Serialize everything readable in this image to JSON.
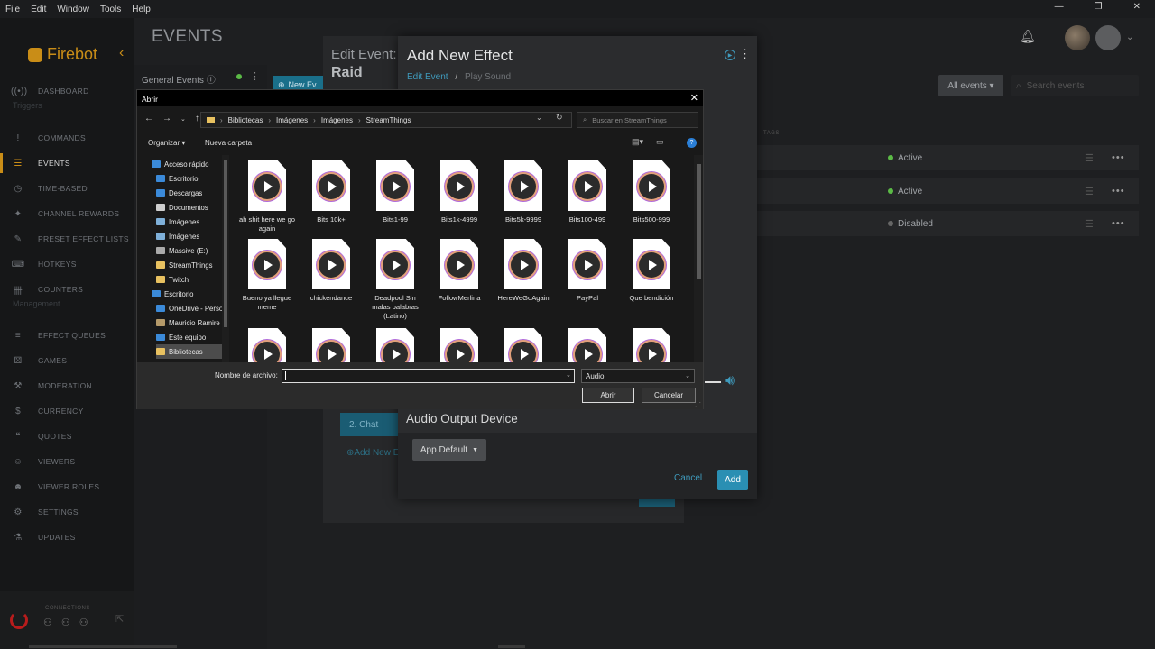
{
  "menu": [
    "File",
    "Edit",
    "Window",
    "Tools",
    "Help"
  ],
  "window_controls": [
    "—",
    "❐",
    "✕"
  ],
  "brand": "Firebot",
  "page_title": "EVENTS",
  "sidebar": {
    "triggers_label": "Triggers",
    "management_label": "Management",
    "items": [
      {
        "label": "DASHBOARD",
        "icon": "broadcast-icon",
        "glyph": "((•))"
      },
      {
        "label": "COMMANDS",
        "icon": "exclamation-icon",
        "glyph": "!"
      },
      {
        "label": "EVENTS",
        "icon": "list-icon",
        "glyph": "☰"
      },
      {
        "label": "TIME-BASED",
        "icon": "clock-icon",
        "glyph": "◷"
      },
      {
        "label": "CHANNEL REWARDS",
        "icon": "gift-icon",
        "glyph": "✦"
      },
      {
        "label": "PRESET EFFECT LISTS",
        "icon": "magic-icon",
        "glyph": "✎"
      },
      {
        "label": "HOTKEYS",
        "icon": "keyboard-icon",
        "glyph": "⌨"
      },
      {
        "label": "COUNTERS",
        "icon": "counter-icon",
        "glyph": "卌"
      },
      {
        "label": "EFFECT QUEUES",
        "icon": "queue-icon",
        "glyph": "≡"
      },
      {
        "label": "GAMES",
        "icon": "dice-icon",
        "glyph": "⚄"
      },
      {
        "label": "MODERATION",
        "icon": "gavel-icon",
        "glyph": "⚒"
      },
      {
        "label": "CURRENCY",
        "icon": "money-icon",
        "glyph": "$"
      },
      {
        "label": "QUOTES",
        "icon": "quote-icon",
        "glyph": "❝"
      },
      {
        "label": "VIEWERS",
        "icon": "users-icon",
        "glyph": "☺"
      },
      {
        "label": "VIEWER ROLES",
        "icon": "user-tag-icon",
        "glyph": "☻"
      },
      {
        "label": "SETTINGS",
        "icon": "gear-icon",
        "glyph": "⚙"
      },
      {
        "label": "UPDATES",
        "icon": "flask-icon",
        "glyph": "⚗"
      }
    ],
    "connections_label": "CONNECTIONS"
  },
  "general_events": {
    "title": "General Events ⓘ"
  },
  "events_toolbar": {
    "all_events": "All events ▾",
    "search_placeholder": "Search events",
    "tags_header": "TAGS"
  },
  "event_rows": [
    {
      "status": "Active",
      "color": "#5bba46"
    },
    {
      "status": "Active",
      "color": "#5bba46"
    },
    {
      "status": "Disabled",
      "color": "#666666"
    }
  ],
  "edit_event": {
    "title": "Edit Event:",
    "name": "Raid",
    "new_effect_btn": "New Ev",
    "chat_effect": "2. Chat",
    "add_new_link": "⊕Add New E"
  },
  "add_effect": {
    "title": "Add New Effect",
    "breadcrumb_link": "Edit Event",
    "breadcrumb_sep": "/",
    "breadcrumb_current": "Play Sound",
    "section_audio": "Audio Output Device",
    "audio_device": "App Default",
    "cancel": "Cancel",
    "add": "Add"
  },
  "file_dialog": {
    "title": "Abrir",
    "path": [
      "Bibliotecas",
      "Imágenes",
      "Imágenes",
      "StreamThings"
    ],
    "search_placeholder": "Buscar en StreamThings",
    "organize": "Organizar ▾",
    "new_folder": "Nueva carpeta",
    "tree": [
      {
        "label": "Acceso rápido",
        "icon": "star-icon",
        "color": "#3b8ad9",
        "indent": 0,
        "pinned": false
      },
      {
        "label": "Escritorio",
        "icon": "desktop-folder-icon",
        "color": "#3b8ad9",
        "indent": 1,
        "pinned": true
      },
      {
        "label": "Descargas",
        "icon": "download-folder-icon",
        "color": "#3b8ad9",
        "indent": 1,
        "pinned": true
      },
      {
        "label": "Documentos",
        "icon": "documents-folder-icon",
        "color": "#cfcfcf",
        "indent": 1,
        "pinned": true
      },
      {
        "label": "Imágenes",
        "icon": "pictures-folder-icon",
        "color": "#7fb0d9",
        "indent": 1,
        "pinned": true
      },
      {
        "label": "Imágenes",
        "icon": "pictures-folder-icon",
        "color": "#7fb0d9",
        "indent": 1,
        "pinned": false
      },
      {
        "label": "Massive (E:)",
        "icon": "drive-icon",
        "color": "#aaaaaa",
        "indent": 1,
        "pinned": false
      },
      {
        "label": "StreamThings",
        "icon": "folder-icon",
        "color": "#e8c160",
        "indent": 1,
        "pinned": false
      },
      {
        "label": "Twitch",
        "icon": "folder-icon",
        "color": "#e8c160",
        "indent": 1,
        "pinned": false
      },
      {
        "label": "Escritorio",
        "icon": "desktop-folder-icon",
        "color": "#3b8ad9",
        "indent": 0,
        "pinned": false
      },
      {
        "label": "OneDrive - Perso",
        "icon": "cloud-icon",
        "color": "#3b8ad9",
        "indent": 1,
        "pinned": false
      },
      {
        "label": "Mauricio Ramire",
        "icon": "user-folder-icon",
        "color": "#b59a6a",
        "indent": 1,
        "pinned": false
      },
      {
        "label": "Este equipo",
        "icon": "computer-icon",
        "color": "#3b8ad9",
        "indent": 1,
        "pinned": false
      },
      {
        "label": "Bibliotecas",
        "icon": "library-icon",
        "color": "#e8c160",
        "indent": 1,
        "pinned": false
      }
    ],
    "files": [
      "ah shit here we go again",
      "Bits 10k+",
      "Bits1-99",
      "Bits1k-4999",
      "Bits5k-9999",
      "Bits100-499",
      "Bits500-999",
      "Bueno ya llegue meme",
      "chickendance",
      "Deadpool Sin malas palabras (Latino)",
      "FollowMerlina",
      "HereWeGoAgain",
      "PayPal",
      "Que bendición",
      "",
      "",
      "",
      "",
      "",
      "",
      ""
    ],
    "filename_label": "Nombre de archivo:",
    "filename_value": "",
    "file_type": "Audio",
    "open_btn": "Abrir",
    "cancel_btn": "Cancelar"
  }
}
